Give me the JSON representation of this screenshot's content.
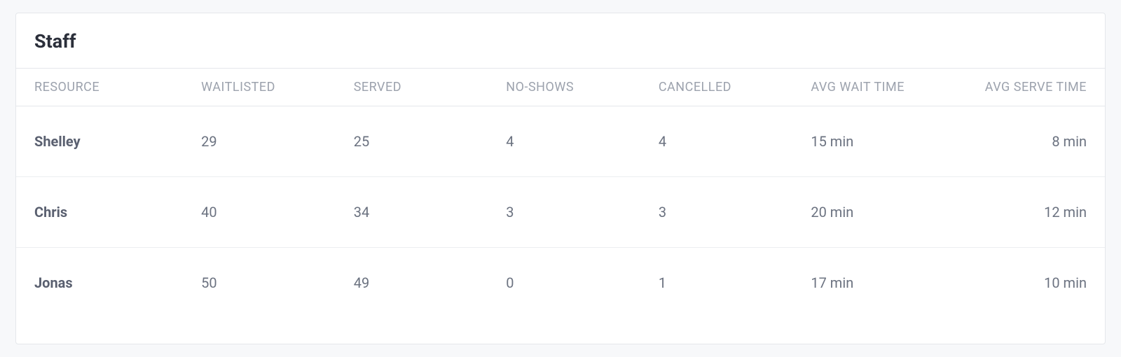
{
  "card": {
    "title": "Staff"
  },
  "table": {
    "headers": {
      "resource": "RESOURCE",
      "waitlisted": "WAITLISTED",
      "served": "SERVED",
      "no_shows": "NO-SHOWS",
      "cancelled": "CANCELLED",
      "avg_wait": "AVG WAIT TIME",
      "avg_serve": "AVG SERVE TIME"
    },
    "rows": [
      {
        "resource": "Shelley",
        "waitlisted": "29",
        "served": "25",
        "no_shows": "4",
        "cancelled": "4",
        "avg_wait": "15 min",
        "avg_serve": "8 min"
      },
      {
        "resource": "Chris",
        "waitlisted": "40",
        "served": "34",
        "no_shows": "3",
        "cancelled": "3",
        "avg_wait": "20 min",
        "avg_serve": "12 min"
      },
      {
        "resource": "Jonas",
        "waitlisted": "50",
        "served": "49",
        "no_shows": "0",
        "cancelled": "1",
        "avg_wait": "17 min",
        "avg_serve": "10 min"
      }
    ]
  }
}
